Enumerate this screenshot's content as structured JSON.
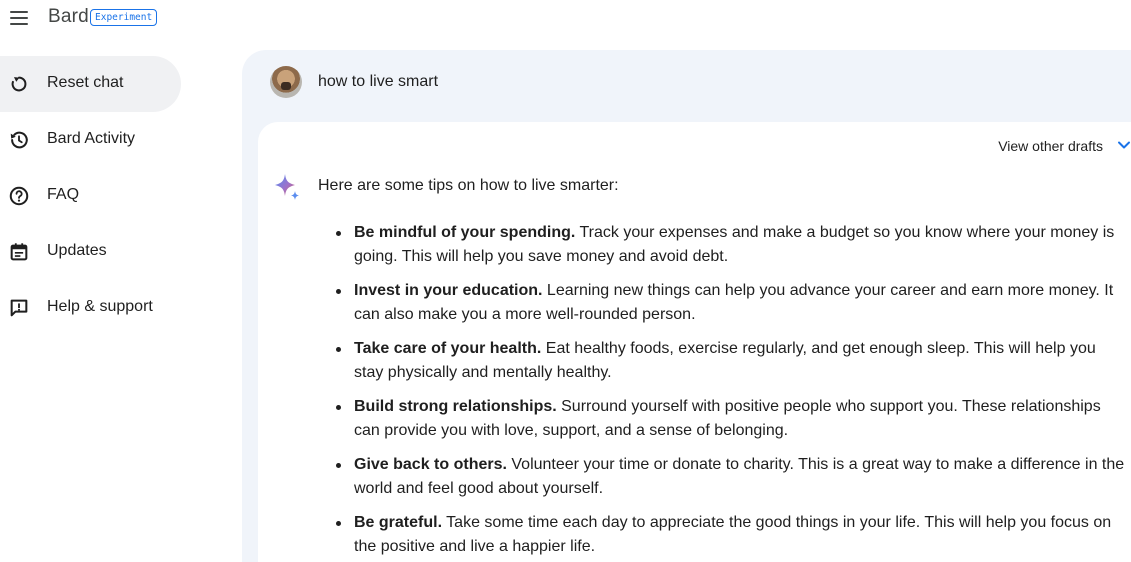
{
  "header": {
    "app_name": "Bard",
    "badge": "Experiment"
  },
  "sidebar": {
    "items": [
      {
        "label": "Reset chat",
        "icon": "reset-icon",
        "active": true
      },
      {
        "label": "Bard Activity",
        "icon": "history-icon",
        "active": false
      },
      {
        "label": "FAQ",
        "icon": "help-circle-icon",
        "active": false
      },
      {
        "label": "Updates",
        "icon": "calendar-icon",
        "active": false
      },
      {
        "label": "Help & support",
        "icon": "feedback-icon",
        "active": false
      }
    ]
  },
  "chat": {
    "user_prompt": "how to live smart",
    "view_drafts_label": "View other drafts",
    "response_intro": "Here are some tips on how to live smarter:",
    "tips": [
      {
        "title": "Be mindful of your spending.",
        "body": " Track your expenses and make a budget so you know where your money is going. This will help you save money and avoid debt."
      },
      {
        "title": "Invest in your education.",
        "body": " Learning new things can help you advance your career and earn more money. It can also make you a more well-rounded person."
      },
      {
        "title": "Take care of your health.",
        "body": " Eat healthy foods, exercise regularly, and get enough sleep. This will help you stay physically and mentally healthy."
      },
      {
        "title": "Build strong relationships.",
        "body": " Surround yourself with positive people who support you. These relationships can provide you with love, support, and a sense of belonging."
      },
      {
        "title": "Give back to others.",
        "body": " Volunteer your time or donate to charity. This is a great way to make a difference in the world and feel good about yourself."
      },
      {
        "title": "Be grateful.",
        "body": " Take some time each day to appreciate the good things in your life. This will help you focus on the positive and live a happier life."
      }
    ]
  },
  "colors": {
    "accent": "#1a73e8",
    "panel_bg": "#f0f4fa",
    "active_nav_bg": "#f0f1f3"
  }
}
